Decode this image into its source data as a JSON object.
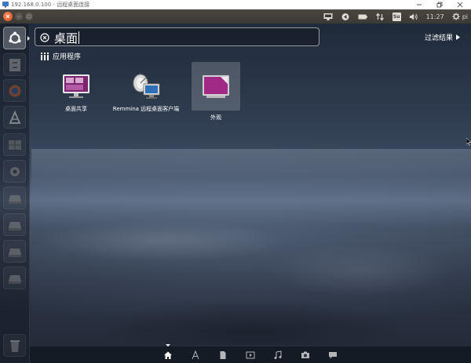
{
  "window": {
    "title": "192.168.0.100 - 远程桌面连接",
    "controls": [
      "minimize-icon",
      "restore-icon",
      "close-icon"
    ]
  },
  "panel": {
    "window_buttons": [
      "close-icon",
      "minimize-icon",
      "maximize-icon"
    ],
    "tray": {
      "keyboard_icon": "keyboard-icon",
      "indicator_icon": "sync-icon",
      "battery_icon": "battery-icon",
      "network_icon": "network-icon",
      "input_method": "Su",
      "volume_icon": "volume-icon",
      "time": "11:27",
      "user_icon": "gear-icon",
      "user": "pi"
    }
  },
  "launcher": {
    "items": [
      {
        "name": "dash-home",
        "icon": "ubuntu-logo-icon",
        "active": true
      },
      {
        "name": "files",
        "icon": "file-cabinet-icon"
      },
      {
        "name": "browser",
        "icon": "globe-icon"
      },
      {
        "name": "software-center",
        "icon": "software-center-icon"
      },
      {
        "name": "workspace",
        "icon": "workspace-icon"
      },
      {
        "name": "settings",
        "icon": "gear-icon"
      },
      {
        "name": "drive-1",
        "icon": "drive-icon"
      },
      {
        "name": "drive-2",
        "icon": "drive-icon"
      },
      {
        "name": "drive-3",
        "icon": "drive-icon"
      },
      {
        "name": "drive-4",
        "icon": "drive-icon"
      },
      {
        "name": "trash",
        "icon": "trash-icon"
      }
    ]
  },
  "search": {
    "query": "桌面",
    "filter_label": "过滤结果"
  },
  "category": {
    "label": "应用程序"
  },
  "results": [
    {
      "label": "桌面共享",
      "icon": "desktop-sharing-icon"
    },
    {
      "label": "Remmina 远程桌面客户端",
      "icon": "remmina-icon"
    },
    {
      "label": "外观",
      "icon": "appearance-icon",
      "selected": true
    }
  ],
  "lenses": [
    {
      "name": "home",
      "icon": "home-icon",
      "active": true
    },
    {
      "name": "applications",
      "icon": "applications-icon"
    },
    {
      "name": "files",
      "icon": "document-icon"
    },
    {
      "name": "video",
      "icon": "video-icon"
    },
    {
      "name": "music",
      "icon": "music-icon"
    },
    {
      "name": "photos",
      "icon": "camera-icon"
    },
    {
      "name": "social",
      "icon": "chat-icon"
    }
  ],
  "colors": {
    "ubuntu_orange": "#dd4814",
    "appearance_purple": "#a02a86",
    "panel": "#3c3a37"
  }
}
